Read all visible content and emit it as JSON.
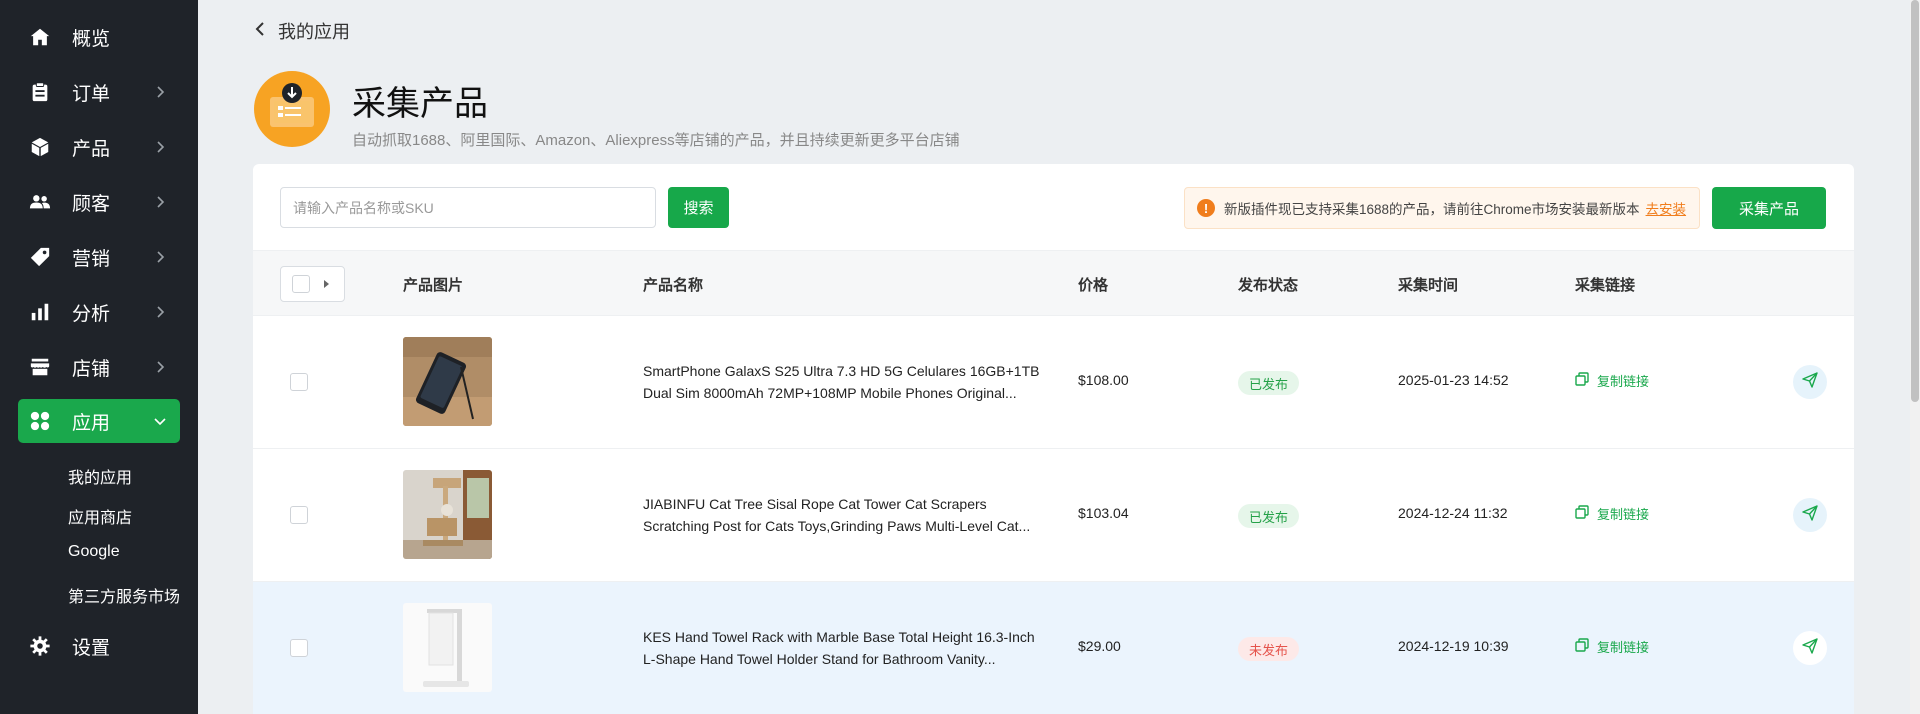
{
  "sidebar": {
    "items": [
      {
        "label": "概览",
        "icon": "home-icon",
        "has_arrow": false
      },
      {
        "label": "订单",
        "icon": "clipboard-icon",
        "has_arrow": true
      },
      {
        "label": "产品",
        "icon": "box-icon",
        "has_arrow": true
      },
      {
        "label": "顾客",
        "icon": "users-icon",
        "has_arrow": true
      },
      {
        "label": "营销",
        "icon": "tag-icon",
        "has_arrow": true
      },
      {
        "label": "分析",
        "icon": "bar-chart-icon",
        "has_arrow": true
      },
      {
        "label": "店铺",
        "icon": "store-icon",
        "has_arrow": true
      },
      {
        "label": "应用",
        "icon": "apps-icon",
        "has_arrow": true,
        "active": true
      },
      {
        "label": "设置",
        "icon": "gear-icon",
        "has_arrow": false
      }
    ],
    "subitems": [
      "我的应用",
      "应用商店",
      "Google",
      "第三方服务市场"
    ]
  },
  "header": {
    "back_label": "我的应用",
    "title": "采集产品",
    "description": "自动抓取1688、阿里国际、Amazon、Aliexpress等店铺的产品，并且持续更新更多平台店铺"
  },
  "toolbar": {
    "search_placeholder": "请输入产品名称或SKU",
    "search_button": "搜索",
    "notice_text": "新版插件现已支持采集1688的产品，请前往Chrome市场安装最新版本",
    "notice_link": "去安装",
    "collect_button": "采集产品"
  },
  "table": {
    "columns": [
      "产品图片",
      "产品名称",
      "价格",
      "发布状态",
      "采集时间",
      "采集链接"
    ],
    "rows": [
      {
        "name_line1": "SmartPhone GalaxS S25 Ultra 7.3 HD 5G Celulares 16GB+1TB",
        "name_line2": "Dual Sim 8000mAh 72MP+108MP Mobile Phones Original...",
        "price": "$108.00",
        "status": "已发布",
        "time": "2025-01-23 14:52",
        "link_label": "复制链接"
      },
      {
        "name_line1": "JIABINFU Cat Tree Sisal Rope Cat Tower Cat Scrapers",
        "name_line2": "Scratching Post for Cats Toys,Grinding Paws Multi-Level Cat...",
        "price": "$103.04",
        "status": "已发布",
        "time": "2024-12-24 11:32",
        "link_label": "复制链接"
      },
      {
        "name_line1": "KES Hand Towel Rack with Marble Base Total Height 16.3-Inch",
        "name_line2": "L-Shape Hand Towel Holder Stand for Bathroom Vanity...",
        "price": "$29.00",
        "status": "未发布",
        "time": "2024-12-19 10:39",
        "link_label": "复制链接"
      }
    ]
  },
  "colors": {
    "sidebar_bg": "#1f2329",
    "accent_green": "#17a84a",
    "warning_orange": "#f07d1c",
    "page_bg": "#eceff2"
  }
}
